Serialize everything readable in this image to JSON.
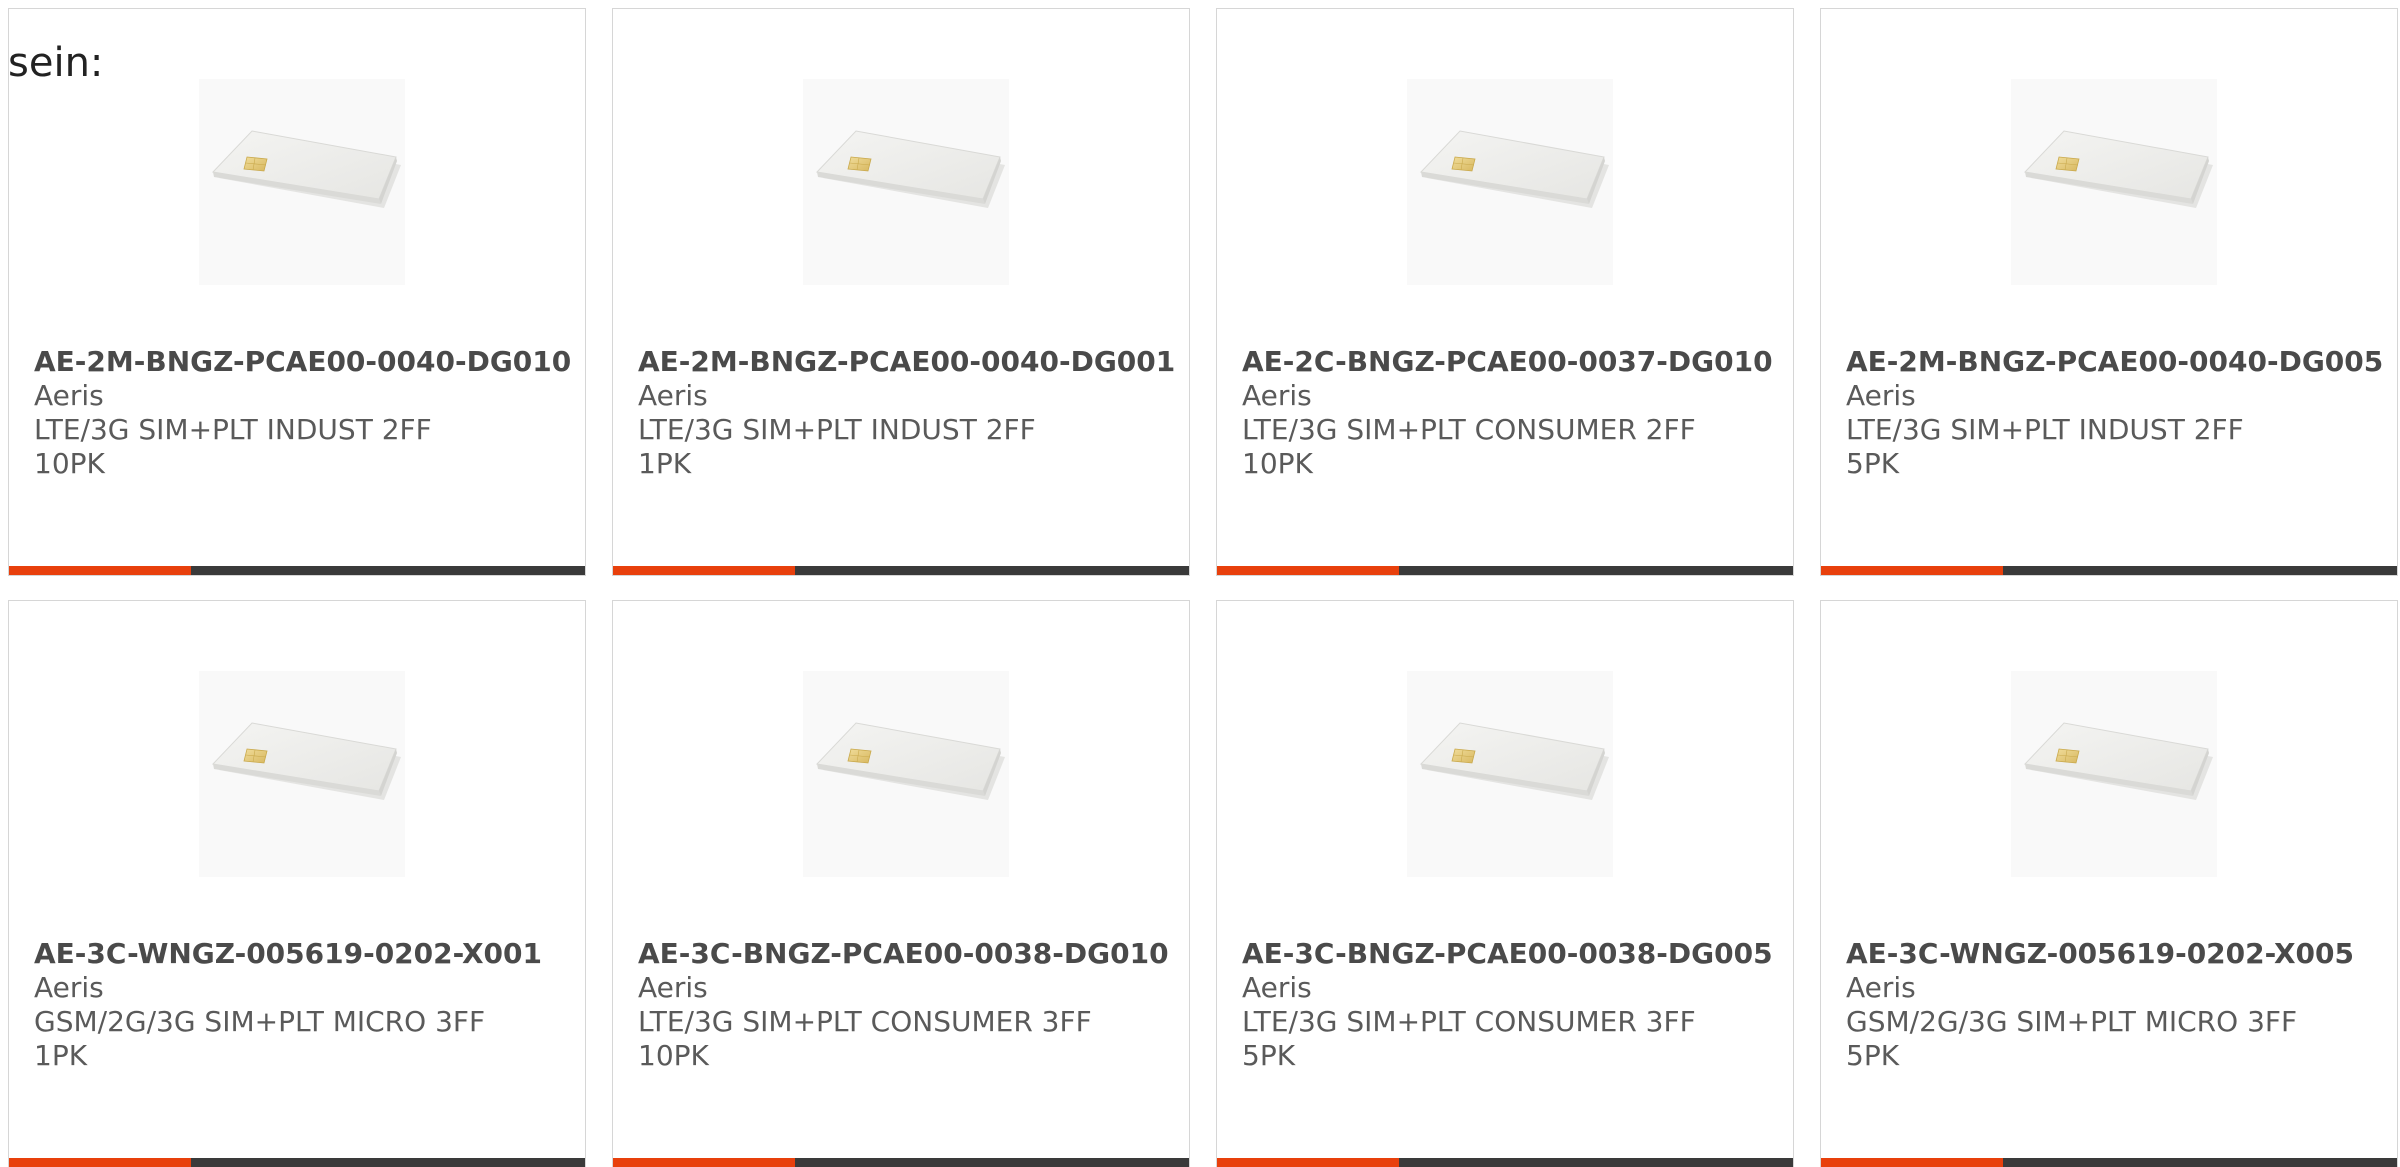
{
  "intro_text": "sein:",
  "colors": {
    "accent": "#e8400c",
    "bar": "#3a3a3a",
    "text": "#5a5a5a",
    "border": "#d6d6d6"
  },
  "products": [
    {
      "part": "AE-2M-BNGZ-PCAE00-0040-DG010",
      "maker": "Aeris",
      "desc": "LTE/3G SIM+PLT INDUST 2FF",
      "qty": "10PK",
      "image_icon": "sim-card-icon"
    },
    {
      "part": "AE-2M-BNGZ-PCAE00-0040-DG001",
      "maker": "Aeris",
      "desc": "LTE/3G SIM+PLT INDUST 2FF",
      "qty": "1PK",
      "image_icon": "sim-card-icon"
    },
    {
      "part": "AE-2C-BNGZ-PCAE00-0037-DG010",
      "maker": "Aeris",
      "desc": "LTE/3G SIM+PLT CONSUMER 2FF",
      "qty": "10PK",
      "image_icon": "sim-card-icon"
    },
    {
      "part": "AE-2M-BNGZ-PCAE00-0040-DG005",
      "maker": "Aeris",
      "desc": "LTE/3G SIM+PLT INDUST 2FF",
      "qty": "5PK",
      "image_icon": "sim-card-icon"
    },
    {
      "part": "AE-3C-WNGZ-005619-0202-X001",
      "maker": "Aeris",
      "desc": "GSM/2G/3G SIM+PLT MICRO 3FF",
      "qty": "1PK",
      "image_icon": "sim-card-icon"
    },
    {
      "part": "AE-3C-BNGZ-PCAE00-0038-DG010",
      "maker": "Aeris",
      "desc": "LTE/3G SIM+PLT CONSUMER 3FF",
      "qty": "10PK",
      "image_icon": "sim-card-icon"
    },
    {
      "part": "AE-3C-BNGZ-PCAE00-0038-DG005",
      "maker": "Aeris",
      "desc": "LTE/3G SIM+PLT CONSUMER 3FF",
      "qty": "5PK",
      "image_icon": "sim-card-icon"
    },
    {
      "part": "AE-3C-WNGZ-005619-0202-X005",
      "maker": "Aeris",
      "desc": "GSM/2G/3G SIM+PLT MICRO 3FF",
      "qty": "5PK",
      "image_icon": "sim-card-icon"
    }
  ]
}
